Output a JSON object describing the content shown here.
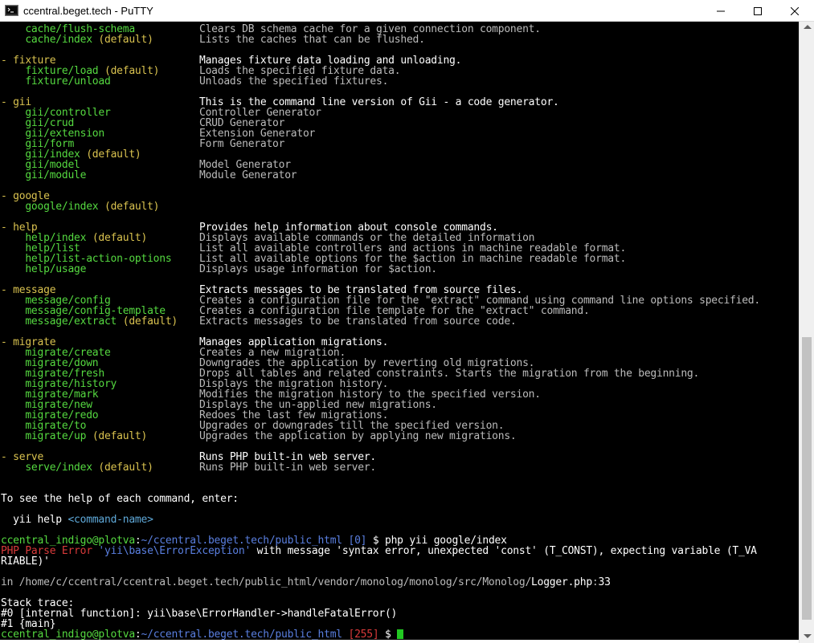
{
  "window": {
    "title": "ccentral.beget.tech - PuTTY",
    "icon": "putty-terminal-icon"
  },
  "terminal": {
    "lines": [
      {
        "segments": [
          {
            "t": "    cache/flush-schema",
            "c": "g"
          }
        ],
        "desc": [
          {
            "t": "Clears DB schema cache for a given connection component.",
            "c": "gr"
          }
        ]
      },
      {
        "segments": [
          {
            "t": "    cache/index ",
            "c": "g"
          },
          {
            "t": "(default)",
            "c": "y"
          }
        ],
        "desc": [
          {
            "t": "Lists the caches that can be flushed.",
            "c": "gr"
          }
        ]
      },
      {
        "segments": [],
        "desc": []
      },
      {
        "segments": [
          {
            "t": "- fixture",
            "c": "y"
          }
        ],
        "desc": [
          {
            "t": "Manages fixture data loading and unloading.",
            "c": "w"
          }
        ]
      },
      {
        "segments": [
          {
            "t": "    fixture/load ",
            "c": "g"
          },
          {
            "t": "(default)",
            "c": "y"
          }
        ],
        "desc": [
          {
            "t": "Loads the specified fixture data.",
            "c": "gr"
          }
        ]
      },
      {
        "segments": [
          {
            "t": "    fixture/unload",
            "c": "g"
          }
        ],
        "desc": [
          {
            "t": "Unloads the specified fixtures.",
            "c": "gr"
          }
        ]
      },
      {
        "segments": [],
        "desc": []
      },
      {
        "segments": [
          {
            "t": "- gii",
            "c": "y"
          }
        ],
        "desc": [
          {
            "t": "This is the command line version of Gii - a code generator.",
            "c": "w"
          }
        ]
      },
      {
        "segments": [
          {
            "t": "    gii/controller",
            "c": "g"
          }
        ],
        "desc": [
          {
            "t": "Controller Generator",
            "c": "gr"
          }
        ]
      },
      {
        "segments": [
          {
            "t": "    gii/crud",
            "c": "g"
          }
        ],
        "desc": [
          {
            "t": "CRUD Generator",
            "c": "gr"
          }
        ]
      },
      {
        "segments": [
          {
            "t": "    gii/extension",
            "c": "g"
          }
        ],
        "desc": [
          {
            "t": "Extension Generator",
            "c": "gr"
          }
        ]
      },
      {
        "segments": [
          {
            "t": "    gii/form",
            "c": "g"
          }
        ],
        "desc": [
          {
            "t": "Form Generator",
            "c": "gr"
          }
        ]
      },
      {
        "segments": [
          {
            "t": "    gii/index ",
            "c": "g"
          },
          {
            "t": "(default)",
            "c": "y"
          }
        ],
        "desc": []
      },
      {
        "segments": [
          {
            "t": "    gii/model",
            "c": "g"
          }
        ],
        "desc": [
          {
            "t": "Model Generator",
            "c": "gr"
          }
        ]
      },
      {
        "segments": [
          {
            "t": "    gii/module",
            "c": "g"
          }
        ],
        "desc": [
          {
            "t": "Module Generator",
            "c": "gr"
          }
        ]
      },
      {
        "segments": [],
        "desc": []
      },
      {
        "segments": [
          {
            "t": "- google",
            "c": "y"
          }
        ],
        "desc": []
      },
      {
        "segments": [
          {
            "t": "    google/index ",
            "c": "g"
          },
          {
            "t": "(default)",
            "c": "y"
          }
        ],
        "desc": []
      },
      {
        "segments": [],
        "desc": []
      },
      {
        "segments": [
          {
            "t": "- help",
            "c": "y"
          }
        ],
        "desc": [
          {
            "t": "Provides help information about console commands.",
            "c": "w"
          }
        ]
      },
      {
        "segments": [
          {
            "t": "    help/index ",
            "c": "g"
          },
          {
            "t": "(default)",
            "c": "y"
          }
        ],
        "desc": [
          {
            "t": "Displays available commands or the detailed information",
            "c": "gr"
          }
        ]
      },
      {
        "segments": [
          {
            "t": "    help/list",
            "c": "g"
          }
        ],
        "desc": [
          {
            "t": "List all available controllers and actions in machine readable format.",
            "c": "gr"
          }
        ]
      },
      {
        "segments": [
          {
            "t": "    help/list-action-options",
            "c": "g"
          }
        ],
        "desc": [
          {
            "t": "List all available options for the $action in machine readable format.",
            "c": "gr"
          }
        ]
      },
      {
        "segments": [
          {
            "t": "    help/usage",
            "c": "g"
          }
        ],
        "desc": [
          {
            "t": "Displays usage information for $action.",
            "c": "gr"
          }
        ]
      },
      {
        "segments": [],
        "desc": []
      },
      {
        "segments": [
          {
            "t": "- message",
            "c": "y"
          }
        ],
        "desc": [
          {
            "t": "Extracts messages to be translated from source files.",
            "c": "w"
          }
        ]
      },
      {
        "segments": [
          {
            "t": "    message/config",
            "c": "g"
          }
        ],
        "desc": [
          {
            "t": "Creates a configuration file for the \"extract\" command using command line options specified.",
            "c": "gr"
          }
        ]
      },
      {
        "segments": [
          {
            "t": "    message/config-template",
            "c": "g"
          }
        ],
        "desc": [
          {
            "t": "Creates a configuration file template for the \"extract\" command.",
            "c": "gr"
          }
        ]
      },
      {
        "segments": [
          {
            "t": "    message/extract ",
            "c": "g"
          },
          {
            "t": "(default)",
            "c": "y"
          }
        ],
        "desc": [
          {
            "t": "Extracts messages to be translated from source code.",
            "c": "gr"
          }
        ]
      },
      {
        "segments": [],
        "desc": []
      },
      {
        "segments": [
          {
            "t": "- migrate",
            "c": "y"
          }
        ],
        "desc": [
          {
            "t": "Manages application migrations.",
            "c": "w"
          }
        ]
      },
      {
        "segments": [
          {
            "t": "    migrate/create",
            "c": "g"
          }
        ],
        "desc": [
          {
            "t": "Creates a new migration.",
            "c": "gr"
          }
        ]
      },
      {
        "segments": [
          {
            "t": "    migrate/down",
            "c": "g"
          }
        ],
        "desc": [
          {
            "t": "Downgrades the application by reverting old migrations.",
            "c": "gr"
          }
        ]
      },
      {
        "segments": [
          {
            "t": "    migrate/fresh",
            "c": "g"
          }
        ],
        "desc": [
          {
            "t": "Drops all tables and related constraints. Starts the migration from the beginning.",
            "c": "gr"
          }
        ]
      },
      {
        "segments": [
          {
            "t": "    migrate/history",
            "c": "g"
          }
        ],
        "desc": [
          {
            "t": "Displays the migration history.",
            "c": "gr"
          }
        ]
      },
      {
        "segments": [
          {
            "t": "    migrate/mark",
            "c": "g"
          }
        ],
        "desc": [
          {
            "t": "Modifies the migration history to the specified version.",
            "c": "gr"
          }
        ]
      },
      {
        "segments": [
          {
            "t": "    migrate/new",
            "c": "g"
          }
        ],
        "desc": [
          {
            "t": "Displays the un-applied new migrations.",
            "c": "gr"
          }
        ]
      },
      {
        "segments": [
          {
            "t": "    migrate/redo",
            "c": "g"
          }
        ],
        "desc": [
          {
            "t": "Redoes the last few migrations.",
            "c": "gr"
          }
        ]
      },
      {
        "segments": [
          {
            "t": "    migrate/to",
            "c": "g"
          }
        ],
        "desc": [
          {
            "t": "Upgrades or downgrades till the specified version.",
            "c": "gr"
          }
        ]
      },
      {
        "segments": [
          {
            "t": "    migrate/up ",
            "c": "g"
          },
          {
            "t": "(default)",
            "c": "y"
          }
        ],
        "desc": [
          {
            "t": "Upgrades the application by applying new migrations.",
            "c": "gr"
          }
        ]
      },
      {
        "segments": [],
        "desc": []
      },
      {
        "segments": [
          {
            "t": "- serve",
            "c": "y"
          }
        ],
        "desc": [
          {
            "t": "Runs PHP built-in web server.",
            "c": "w"
          }
        ]
      },
      {
        "segments": [
          {
            "t": "    serve/index ",
            "c": "g"
          },
          {
            "t": "(default)",
            "c": "y"
          }
        ],
        "desc": [
          {
            "t": "Runs PHP built-in web server.",
            "c": "gr"
          }
        ]
      },
      {
        "segments": [],
        "desc": []
      },
      {
        "segments": [],
        "desc": []
      },
      {
        "segments": [
          {
            "t": "To see the help of each command, enter:",
            "c": "w"
          }
        ],
        "desc": []
      },
      {
        "segments": [],
        "desc": []
      },
      {
        "segments": [
          {
            "t": "  yii help ",
            "c": "w"
          },
          {
            "t": "<command-name>",
            "c": "c"
          }
        ],
        "desc": []
      },
      {
        "segments": [],
        "desc": []
      },
      {
        "segments": [
          {
            "t": "ccentral_indigo@plotva",
            "c": "g"
          },
          {
            "t": ":",
            "c": "w"
          },
          {
            "t": "~/ccentral.beget.tech/public_html",
            "c": "b"
          },
          {
            "t": " [0] ",
            "c": "b"
          },
          {
            "t": "$ php yii google/index",
            "c": "w"
          }
        ],
        "desc": []
      },
      {
        "segments": [
          {
            "t": "PHP Parse Error ",
            "c": "r"
          },
          {
            "t": "'yii\\base\\ErrorException'",
            "c": "b"
          },
          {
            "t": " with message 'syntax error, unexpected 'const' (T_CONST), expecting variable (T_VA",
            "c": "w"
          }
        ],
        "desc": []
      },
      {
        "segments": [
          {
            "t": "RIABLE)'",
            "c": "w"
          }
        ],
        "desc": []
      },
      {
        "segments": [],
        "desc": []
      },
      {
        "segments": [
          {
            "t": "in /home/c/ccentral/ccentral.beget.tech/public_html/vendor/monolog/monolog/src/Monolog/",
            "c": "gr"
          },
          {
            "t": "Logger.php",
            "c": "w"
          },
          {
            "t": ":",
            "c": "gr"
          },
          {
            "t": "33",
            "c": "w"
          }
        ],
        "desc": []
      },
      {
        "segments": [],
        "desc": []
      },
      {
        "segments": [
          {
            "t": "Stack trace:",
            "c": "w"
          }
        ],
        "desc": []
      },
      {
        "segments": [
          {
            "t": "#0 [internal function]: yii\\base\\ErrorHandler->handleFatalError()",
            "c": "w"
          }
        ],
        "desc": []
      },
      {
        "segments": [
          {
            "t": "#1 {main}",
            "c": "w"
          }
        ],
        "desc": []
      },
      {
        "segments": [
          {
            "t": "ccentral_indigo@plotva",
            "c": "g"
          },
          {
            "t": ":",
            "c": "w"
          },
          {
            "t": "~/ccentral.beget.tech/public_html",
            "c": "b"
          },
          {
            "t": " [255] ",
            "c": "r"
          },
          {
            "t": "$ ",
            "c": "w"
          }
        ],
        "desc": [],
        "cursor": true
      }
    ]
  }
}
